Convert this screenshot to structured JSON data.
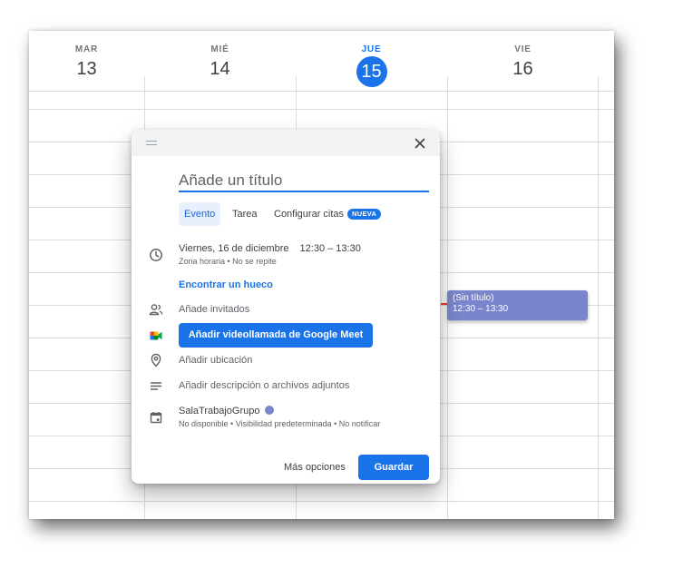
{
  "calendar": {
    "days": [
      {
        "name": "MAR",
        "num": "13"
      },
      {
        "name": "MIÉ",
        "num": "14"
      },
      {
        "name": "JUE",
        "num": "15"
      },
      {
        "name": "VIE",
        "num": "16"
      }
    ],
    "event": {
      "title": "(Sin título)",
      "time": "12:30 – 13:30",
      "color": "#7986cb"
    }
  },
  "dialog": {
    "title_placeholder": "Añade un título",
    "tabs": [
      {
        "label": "Evento"
      },
      {
        "label": "Tarea"
      },
      {
        "label": "Configurar citas",
        "badge": "NUEVA"
      }
    ],
    "date": "Viernes, 16 de diciembre",
    "time_range": "12:30 – 13:30",
    "time_details": "Zona horaria • No se repite",
    "find_time_link": "Encontrar un hueco",
    "guests": "Añade invitados",
    "meet_button": "Añadir videollamada de Google Meet",
    "location": "Añadir ubicación",
    "description": "Añadir descripción o archivos adjuntos",
    "calendar_name": "SalaTrabajoGrupo",
    "calendar_color": "#7986cb",
    "calendar_details": "No disponible • Visibilidad predeterminada • No notificar",
    "more_options": "Más opciones",
    "save": "Guardar"
  },
  "colors": {
    "accent": "#1a73e8",
    "event": "#7986cb"
  }
}
